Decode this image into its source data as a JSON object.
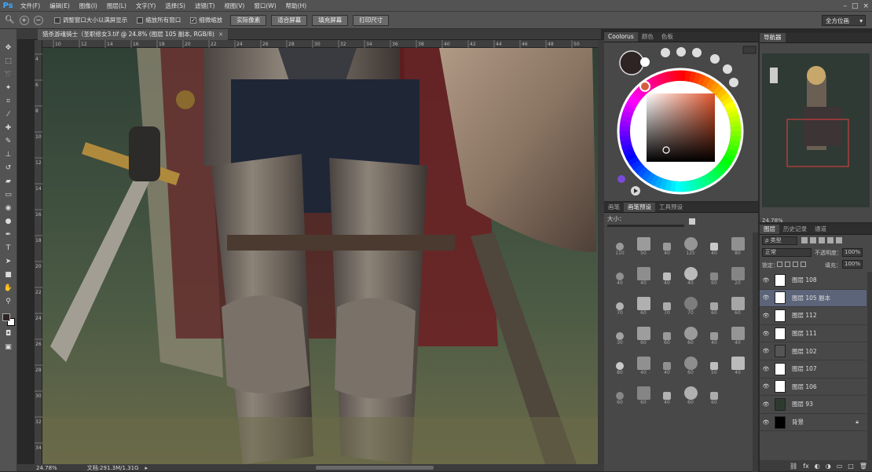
{
  "app_logo": "Ps",
  "menu": [
    "文件(F)",
    "编辑(E)",
    "图像(I)",
    "图层(L)",
    "文字(Y)",
    "选择(S)",
    "滤镜(T)",
    "视图(V)",
    "窗口(W)",
    "帮助(H)"
  ],
  "options": {
    "check1": "调整窗口大小以满屏显示",
    "check2": "缩放所有窗口",
    "check3": "细微缩放",
    "btn1": "实际像素",
    "btn2": "适合屏幕",
    "btn3": "填充屏幕",
    "btn4": "打印尺寸",
    "workspace": "全方位画"
  },
  "document": {
    "tab_title": "猎杀游魂骑士（圣职修女3.tif @ 24.8% (图层 105 副本, RGB/8)",
    "close": "×"
  },
  "ruler_numbers": [
    "10",
    "12",
    "14",
    "16",
    "18",
    "20",
    "22",
    "24",
    "26",
    "28",
    "30",
    "32",
    "34",
    "36",
    "38",
    "40",
    "42",
    "44",
    "46",
    "48",
    "50"
  ],
  "ruler_left_numbers": [
    "4",
    "6",
    "8",
    "10",
    "12",
    "14",
    "16",
    "18",
    "20",
    "22",
    "24",
    "26",
    "28",
    "30",
    "32",
    "34"
  ],
  "status": {
    "zoom": "24.78%",
    "doc_size": "文档:291.3M/1.31G"
  },
  "coolorus": {
    "tabs": [
      "Coolorus",
      "颜色",
      "色板"
    ],
    "fg_color": "#2e2424",
    "picked_color": "#d75b3f"
  },
  "brush_panel": {
    "tabs": [
      "画笔",
      "画笔预设",
      "工具预设"
    ],
    "size_label": "大小：",
    "numbers": [
      "110",
      "50",
      "40",
      "125",
      "40",
      "80",
      "40",
      "40",
      "40",
      "40",
      "60",
      "20",
      "70",
      "60",
      "70",
      "70",
      "60",
      "60",
      "30",
      "60",
      "60",
      "60",
      "40",
      "40",
      "80",
      "40",
      "40",
      "60",
      "50",
      "40",
      "60",
      "60",
      "40",
      "60",
      "60"
    ]
  },
  "navigator": {
    "title": "导航器",
    "zoom": "24.78%"
  },
  "layers": {
    "tabs": [
      "图层",
      "历史记录",
      "通道"
    ],
    "kind": "ρ 类型",
    "blend": "正常",
    "opacity_label": "不透明度：",
    "opacity": "100%",
    "lock_label": "锁定：",
    "fill_label": "填充：",
    "fill": "100%",
    "items": [
      {
        "name": "图层 108",
        "selected": false
      },
      {
        "name": "图层 105 副本",
        "selected": true
      },
      {
        "name": "图层 112",
        "selected": false
      },
      {
        "name": "图层 111",
        "selected": false
      },
      {
        "name": "图层 102",
        "selected": false
      },
      {
        "name": "图层 107",
        "selected": false
      },
      {
        "name": "图层 106",
        "selected": false
      },
      {
        "name": "图层 93",
        "selected": false
      },
      {
        "name": "背景",
        "selected": false
      }
    ]
  }
}
